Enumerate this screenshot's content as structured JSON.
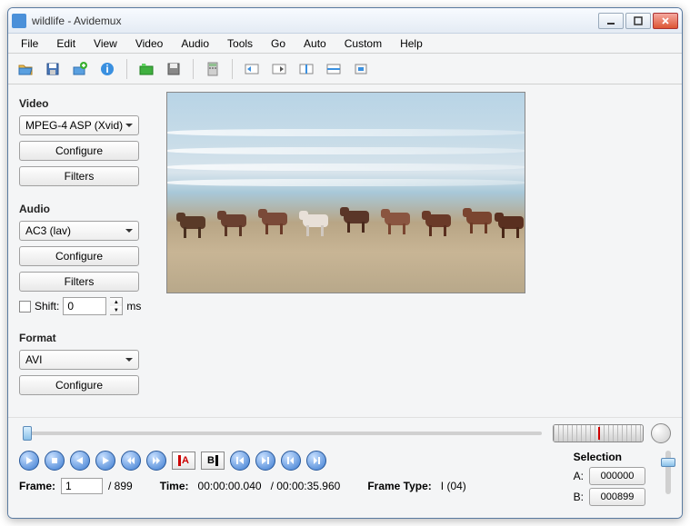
{
  "window": {
    "title": "wildlife - Avidemux"
  },
  "menu": {
    "items": [
      "File",
      "Edit",
      "View",
      "Video",
      "Audio",
      "Tools",
      "Go",
      "Auto",
      "Custom",
      "Help"
    ]
  },
  "video": {
    "label": "Video",
    "codec": "MPEG-4 ASP (Xvid)",
    "configure": "Configure",
    "filters": "Filters"
  },
  "audio": {
    "label": "Audio",
    "codec": "AC3 (lav)",
    "configure": "Configure",
    "filters": "Filters",
    "shift_label": "Shift:",
    "shift_value": "0",
    "shift_unit": "ms"
  },
  "format": {
    "label": "Format",
    "container": "AVI",
    "configure": "Configure"
  },
  "selection": {
    "label": "Selection",
    "a_label": "A:",
    "a_value": "000000",
    "b_label": "B:",
    "b_value": "000899"
  },
  "status": {
    "frame_label": "Frame:",
    "frame_current": "1",
    "frame_total": "/ 899",
    "time_label": "Time:",
    "time_current": "00:00:00.040",
    "time_total": "/ 00:00:35.960",
    "frametype_label": "Frame Type:",
    "frametype_value": "I (04)"
  }
}
